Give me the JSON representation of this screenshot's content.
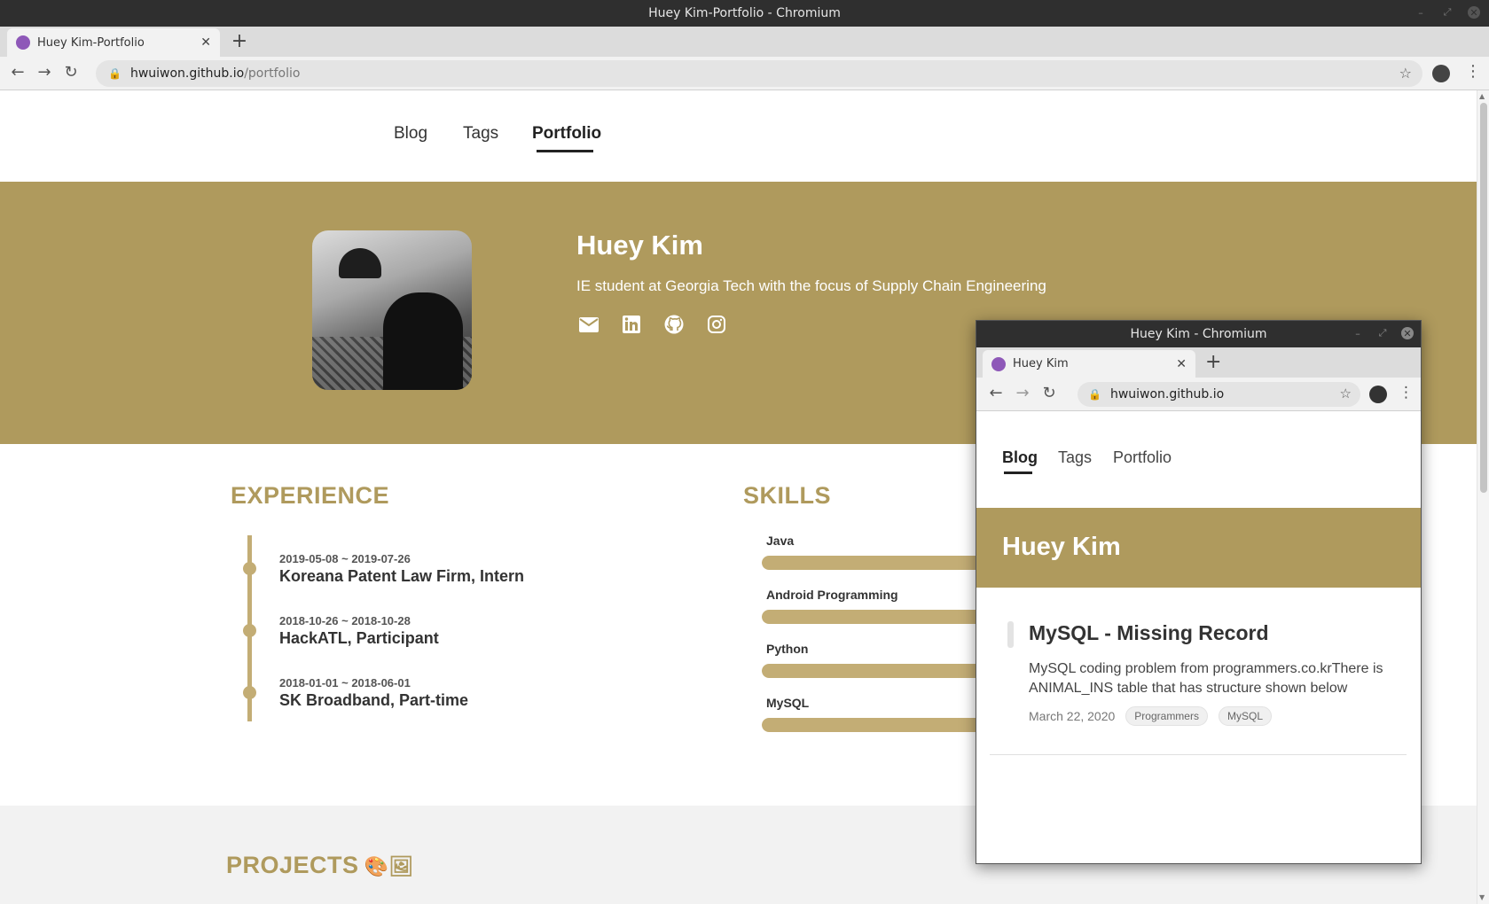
{
  "window": {
    "title": "Huey Kim-Portfolio - Chromium",
    "tab_title": "Huey Kim-Portfolio",
    "url_host": "hwuiwon.github.io",
    "url_path": "/portfolio"
  },
  "nav": {
    "blog": "Blog",
    "tags": "Tags",
    "portfolio": "Portfolio",
    "active": "Portfolio"
  },
  "hero": {
    "name": "Huey Kim",
    "subtitle": "IE student at Georgia Tech with the focus of Supply Chain Engineering",
    "icons": [
      "envelope-icon",
      "linkedin-icon",
      "github-icon",
      "instagram-icon"
    ]
  },
  "experience": {
    "title": "EXPERIENCE",
    "items": [
      {
        "date": "2019-05-08 ~ 2019-07-26",
        "title": "Koreana Patent Law Firm, Intern"
      },
      {
        "date": "2018-10-26 ~ 2018-10-28",
        "title": "HackATL, Participant"
      },
      {
        "date": "2018-01-01 ~ 2018-06-01",
        "title": "SK Broadband, Part-time"
      }
    ]
  },
  "skills": {
    "title": "SKILLS",
    "items": [
      {
        "name": "Java",
        "level": 1.0
      },
      {
        "name": "Android Programming",
        "level": 1.0
      },
      {
        "name": "Python",
        "level": 1.0
      },
      {
        "name": "MySQL",
        "level": 1.0
      }
    ]
  },
  "projects": {
    "title": "PROJECTS",
    "emoji": "🎨🖼"
  },
  "popup": {
    "title": "Huey Kim - Chromium",
    "tab_title": "Huey Kim",
    "url": "hwuiwon.github.io",
    "nav": {
      "blog": "Blog",
      "tags": "Tags",
      "portfolio": "Portfolio",
      "active": "Blog"
    },
    "hero_name": "Huey Kim",
    "post": {
      "title": "MySQL - Missing Record",
      "excerpt": "MySQL coding problem from programmers.co.krThere is ANIMAL_INS table that has structure shown below",
      "date": "March 22, 2020",
      "tags": [
        "Programmers",
        "MySQL"
      ]
    }
  },
  "colors": {
    "accent": "#af9a5d",
    "accent_light": "#c3ad75",
    "chrome_dark": "#2f2f2f",
    "favicon": "#8e58b8"
  }
}
